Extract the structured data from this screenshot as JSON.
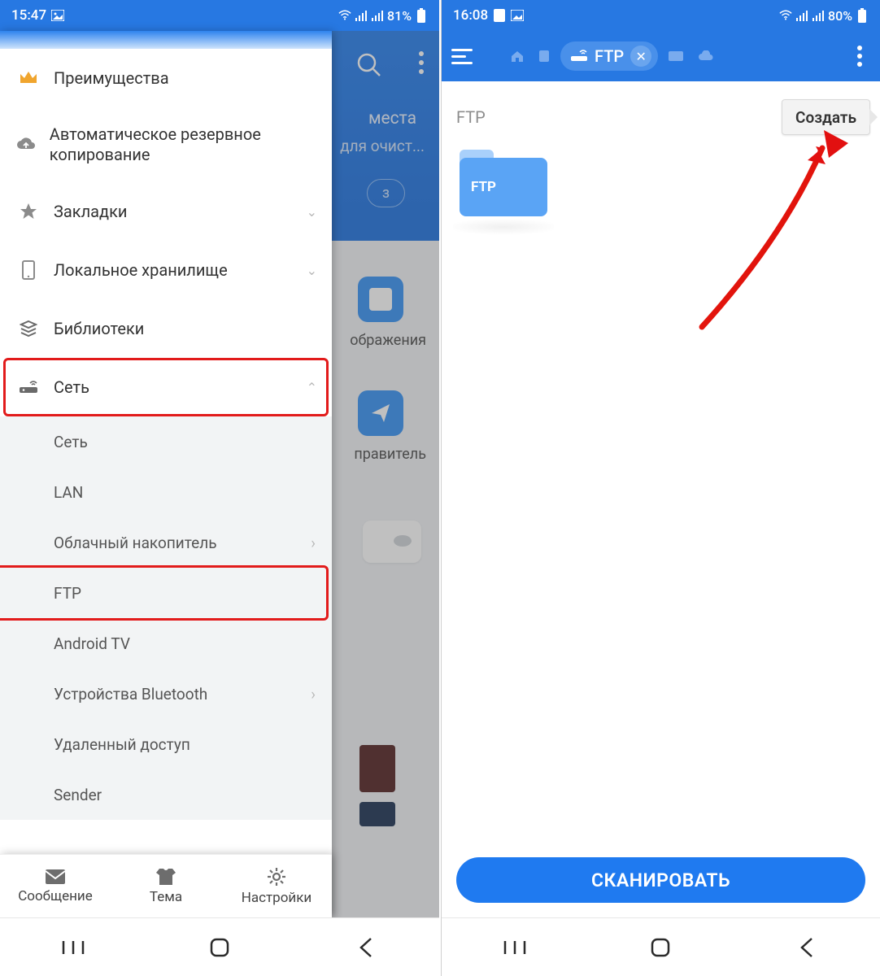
{
  "left": {
    "status": {
      "time": "15:47",
      "battery": "81%"
    },
    "background": {
      "hint_line1": "места",
      "hint_line2": "для очист...",
      "pill": "з",
      "tile_images": "ображения",
      "tile_sender": "правитель"
    },
    "drawer": {
      "items": [
        {
          "icon": "crown",
          "label": "Преимущества"
        },
        {
          "icon": "cloud-up",
          "label": "Автоматическое резервное копирование"
        },
        {
          "icon": "star",
          "label": "Закладки",
          "chevron": true
        },
        {
          "icon": "phone",
          "label": "Локальное хранилище",
          "chevron": true
        },
        {
          "icon": "stacks",
          "label": "Библиотеки"
        },
        {
          "icon": "router",
          "label": "Сеть",
          "chevron_up": true,
          "highlight": true
        }
      ],
      "sub": [
        {
          "label": "Сеть"
        },
        {
          "label": "LAN"
        },
        {
          "label": "Облачный накопитель",
          "chevron": true
        },
        {
          "label": "FTP",
          "highlight": true
        },
        {
          "label": "Android TV"
        },
        {
          "label": "Устройства Bluetooth",
          "chevron": true
        },
        {
          "label": "Удаленный доступ"
        },
        {
          "label": "Sender"
        }
      ],
      "footer": {
        "msg": "Сообщение",
        "theme": "Тема",
        "settings": "Настройки"
      }
    }
  },
  "right": {
    "status": {
      "time": "16:08",
      "battery": "80%"
    },
    "header": {
      "tab_label": "FTP"
    },
    "title": "FTP",
    "create_label": "Создать",
    "folder_label": "FTP",
    "scan_label": "СКАНИРОВАТЬ"
  }
}
